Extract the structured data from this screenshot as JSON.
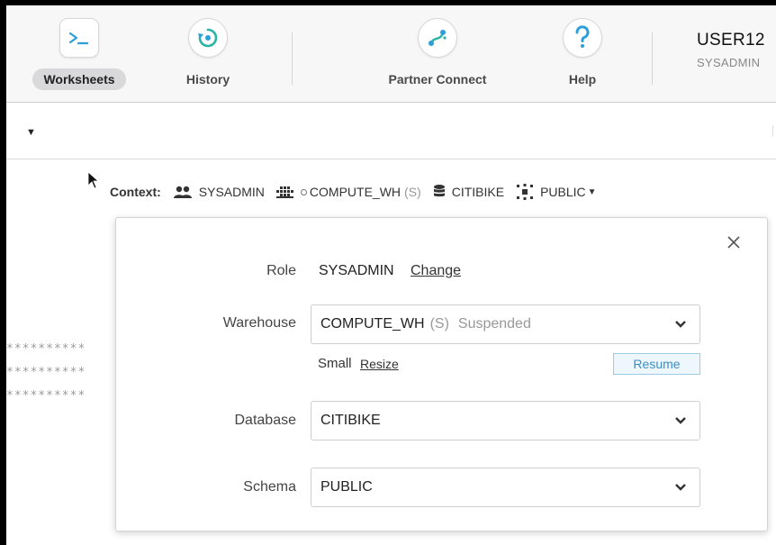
{
  "toolbar": {
    "buttons": [
      {
        "label": "Worksheets",
        "icon": "terminal-icon",
        "active": true
      },
      {
        "label": "History",
        "icon": "history-icon",
        "active": false
      },
      {
        "label": "Partner Connect",
        "icon": "partner-connect-icon",
        "active": false
      },
      {
        "label": "Help",
        "icon": "help-icon",
        "active": false
      }
    ],
    "user_name": "USER12",
    "user_role": "SYSADMIN"
  },
  "context": {
    "label": "Context:",
    "role": "SYSADMIN",
    "warehouse": "COMPUTE_WH",
    "warehouse_size": "(S)",
    "database": "CITIBIKE",
    "schema": "PUBLIC"
  },
  "background_lines": [
    "**********",
    "**********",
    "**********"
  ],
  "panel": {
    "role_label": "Role",
    "role_value": "SYSADMIN",
    "change_link": "Change",
    "warehouse_label": "Warehouse",
    "warehouse_value": "COMPUTE_WH",
    "warehouse_size": "(S)",
    "warehouse_status": "Suspended",
    "size_text": "Small",
    "resize_link": "Resize",
    "resume_button": "Resume",
    "database_label": "Database",
    "database_value": "CITIBIKE",
    "schema_label": "Schema",
    "schema_value": "PUBLIC"
  },
  "colors": {
    "accent_green": "#2bb3a3",
    "accent_blue": "#2d9fd8",
    "resume_blue": "#3a8fc8"
  }
}
